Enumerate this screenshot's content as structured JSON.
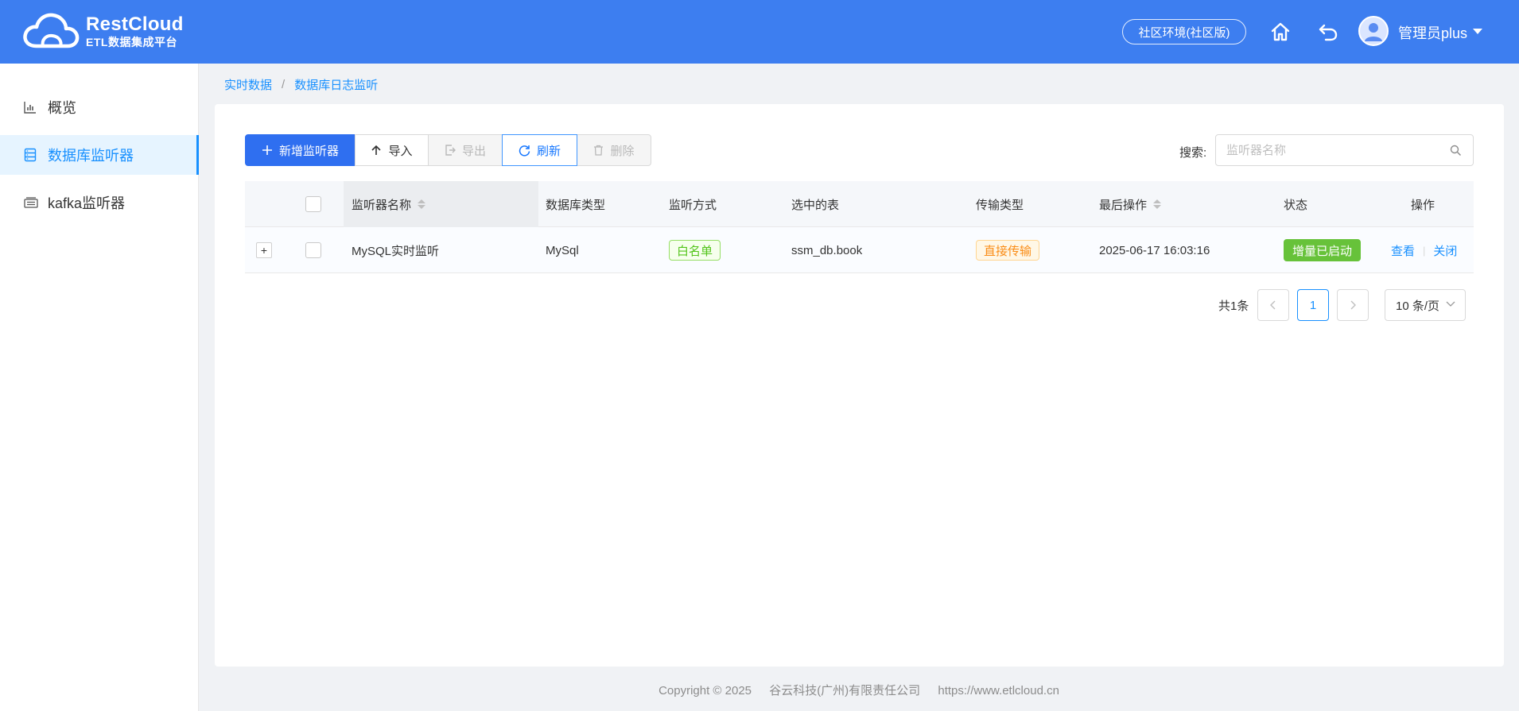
{
  "header": {
    "logo_title": "RestCloud",
    "logo_subtitle": "ETL数据集成平台",
    "env_label": "社区环境(社区版)",
    "user_name": "管理员plus",
    "colors": {
      "header_bg": "#3d7ef0",
      "primary": "#2f6ff0",
      "link": "#1890ff"
    }
  },
  "sidebar": {
    "items": [
      {
        "label": "概览",
        "icon": "bar-chart-icon"
      },
      {
        "label": "数据库监听器",
        "icon": "database-icon",
        "active": true
      },
      {
        "label": "kafka监听器",
        "icon": "kafka-icon"
      }
    ]
  },
  "breadcrumb": {
    "items": [
      "实时数据",
      "数据库日志监听"
    ]
  },
  "toolbar": {
    "add_label": "新增监听器",
    "import_label": "导入",
    "export_label": "导出",
    "refresh_label": "刷新",
    "delete_label": "删除"
  },
  "search": {
    "label": "搜索:",
    "placeholder": "监听器名称"
  },
  "table": {
    "columns": [
      "监听器名称",
      "数据库类型",
      "监听方式",
      "选中的表",
      "传输类型",
      "最后操作",
      "状态",
      "操作"
    ],
    "rows": [
      {
        "name": "MySQL实时监听",
        "db_type": "MySql",
        "mode": "白名单",
        "table": "ssm_db.book",
        "transfer": "直接传输",
        "last_op": "2025-06-17 16:03:16",
        "status": "增量已启动",
        "action_view": "查看",
        "action_close": "关闭"
      }
    ]
  },
  "pagination": {
    "total": "共1条",
    "current_page": "1",
    "page_size": "10 条/页"
  },
  "footer": {
    "copyright": "Copyright © 2025",
    "company": "谷云科技(广州)有限责任公司",
    "url": "https://www.etlcloud.cn"
  }
}
